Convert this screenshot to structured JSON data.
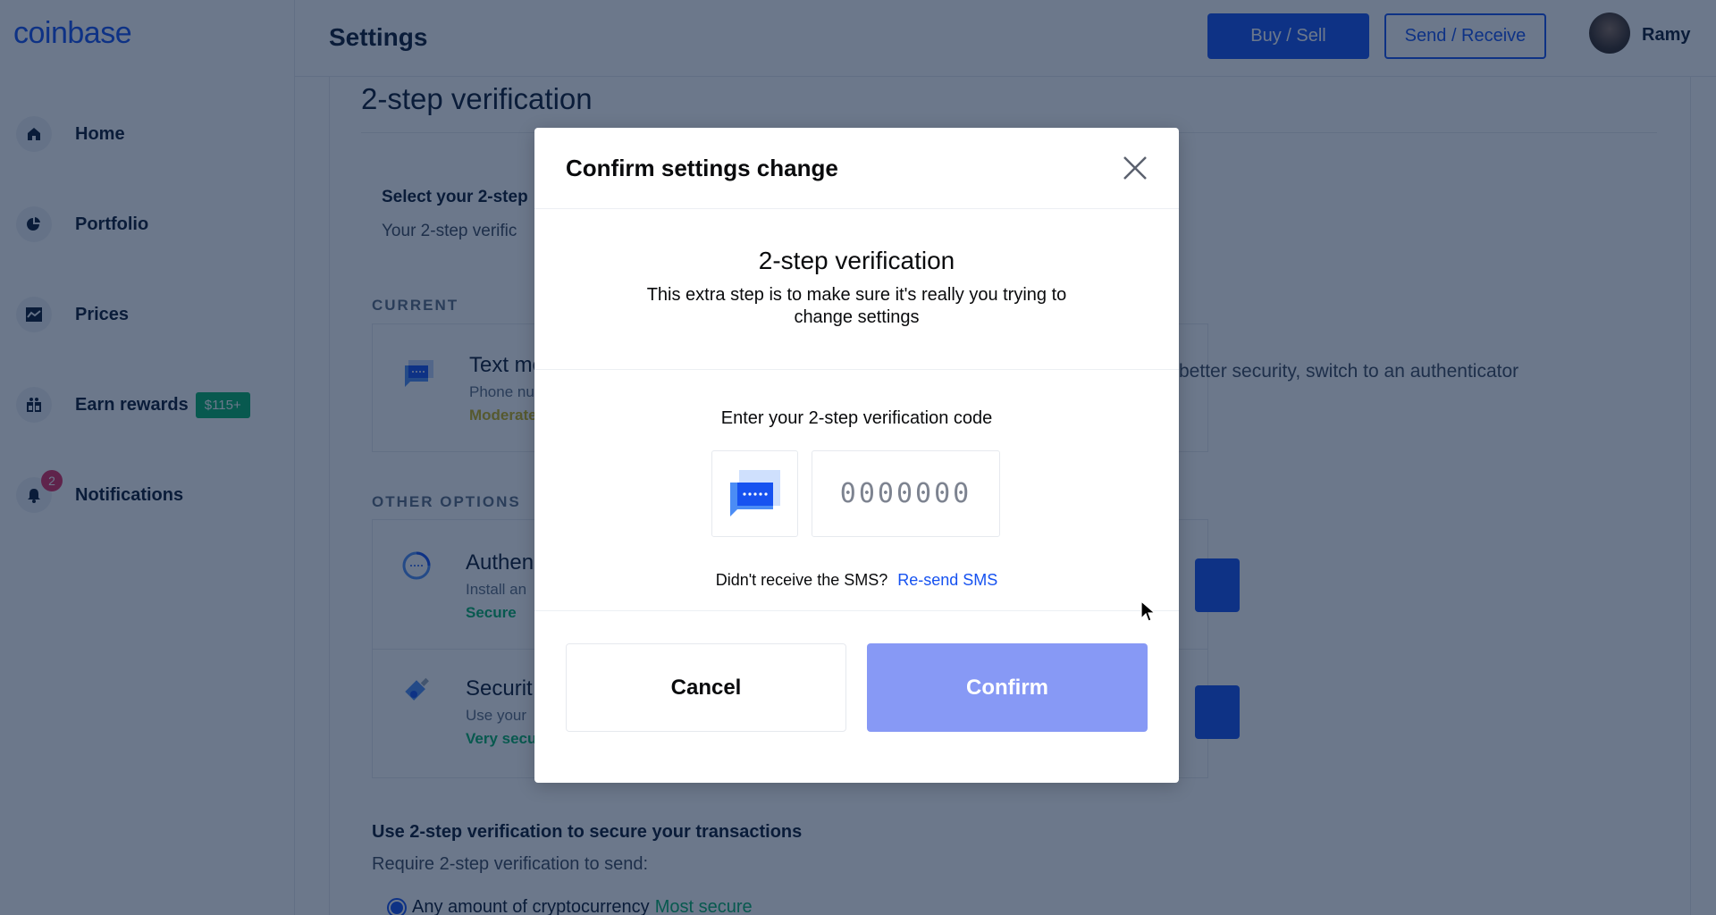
{
  "sidebar": {
    "logo": "coinbase",
    "items": [
      {
        "label": "Home",
        "icon": "home-icon"
      },
      {
        "label": "Portfolio",
        "icon": "pie-chart-icon"
      },
      {
        "label": "Prices",
        "icon": "chart-icon"
      },
      {
        "label": "Earn rewards",
        "icon": "gift-icon",
        "badge": "$115+"
      },
      {
        "label": "Notifications",
        "icon": "bell-icon",
        "count": "2"
      }
    ]
  },
  "header": {
    "title": "Settings",
    "buy_sell_label": "Buy / Sell",
    "send_receive_label": "Send / Receive",
    "user_name": "Ramy"
  },
  "page": {
    "section_title": "2-step verification",
    "select_title": "Select your 2-step",
    "select_desc": "Your 2-step verific",
    "current_label": "CURRENT",
    "current_option": {
      "title": "Text me",
      "subtitle": "Phone nu",
      "level": "Moderate",
      "note": "better security, switch to an authenticator"
    },
    "other_label": "OTHER OPTIONS",
    "other_options": [
      {
        "title": "Authen",
        "subtitle": "Install an",
        "level": "Secure"
      },
      {
        "title": "Securit",
        "subtitle": "Use your",
        "level": "Very secu"
      }
    ],
    "tx_title": "Use 2-step verification to secure your transactions",
    "tx_desc": "Require 2-step verification to send:",
    "radio_label": "Any amount of cryptocurrency",
    "radio_tag": "Most secure"
  },
  "modal": {
    "title": "Confirm settings change",
    "intro_title": "2-step verification",
    "intro_desc": "This extra step is to make sure it's really you trying to change settings",
    "code_label": "Enter your 2-step verification code",
    "code_placeholder": "0000000",
    "code_value": "",
    "resend_prompt": "Didn't receive the SMS?",
    "resend_link": "Re-send SMS",
    "cancel_label": "Cancel",
    "confirm_label": "Confirm"
  },
  "colors": {
    "brand": "#1652f0",
    "confirm_disabled": "#8799f5",
    "success": "#05b169",
    "moderate": "#c9b21a",
    "notification": "#df2c5f"
  }
}
